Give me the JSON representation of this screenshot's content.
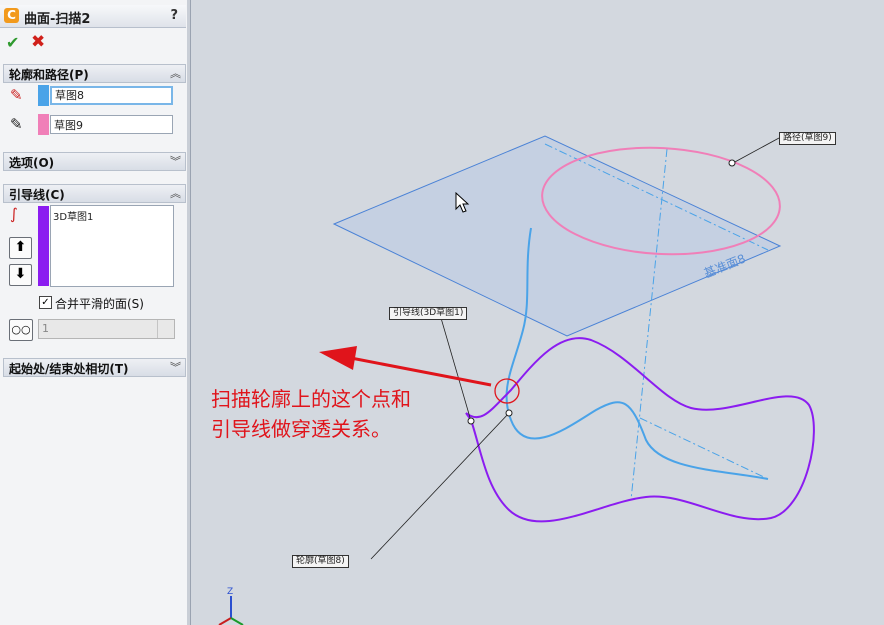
{
  "panel": {
    "title": "曲面-扫描2",
    "title_icon": "C",
    "help": "?",
    "ok_icon": "checkmark-icon",
    "cancel_icon": "x-icon",
    "groups": {
      "profile_path": {
        "label": "轮廓和路径(P)",
        "profile_value": "草图8",
        "path_value": "草图9",
        "profile_color": "#4aa3e8",
        "path_color": "#f07fb8"
      },
      "options": {
        "label": "选项(O)"
      },
      "guides": {
        "label": "引导线(C)",
        "items": [
          "3D草图1"
        ],
        "guide_color": "#8b1cf0",
        "merge_label": "合并平滑的面(S)",
        "merge_checked": true,
        "spin_value": "1"
      },
      "tangency": {
        "label": "起始处/结束处相切(T)"
      }
    }
  },
  "canvas": {
    "callout_path": "路径(草图9)",
    "callout_guide": "引导线(3D草图1)",
    "callout_profile": "轮廓(草图8)",
    "plane_label": "基准面8",
    "annotation_line1": "扫描轮廓上的这个点和",
    "annotation_line2": "引导线做穿透关系。",
    "annotation_color": "#e0141b",
    "triad_label": "Z"
  }
}
